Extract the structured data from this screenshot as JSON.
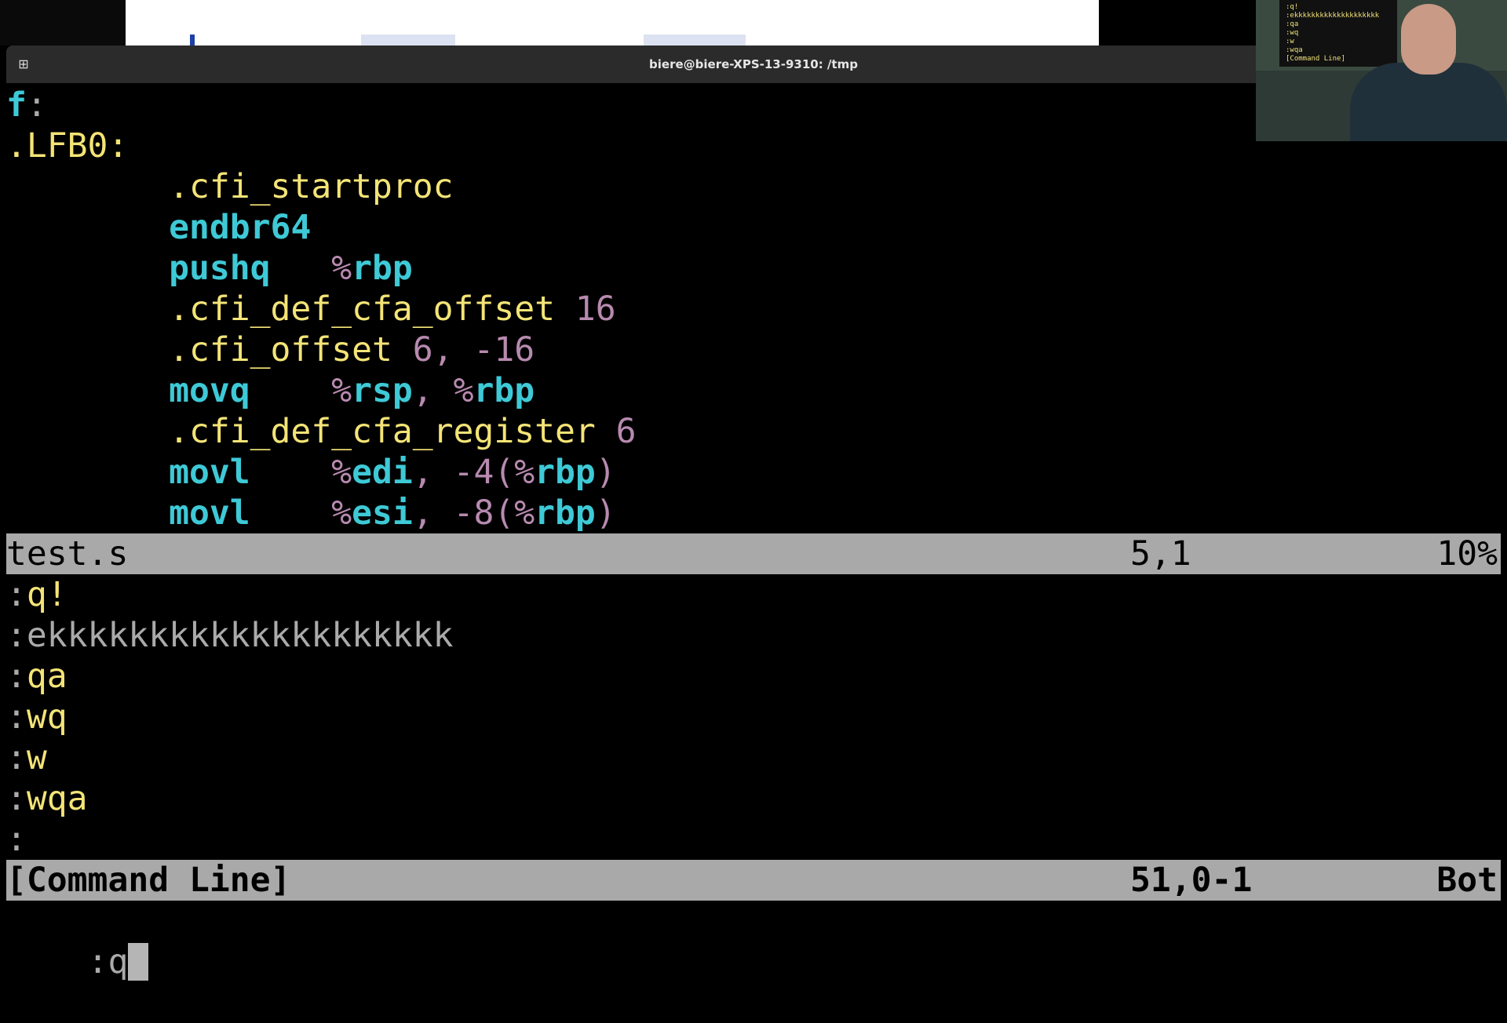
{
  "window": {
    "title": "biere@biere-XPS-13-9310: /tmp",
    "new_tab_icon": "new-tab-icon"
  },
  "editor": {
    "file_lines": [
      [
        {
          "t": "f",
          "k": "c"
        },
        {
          "t": ":",
          "k": "g"
        }
      ],
      [
        {
          "t": ".LFB0:",
          "k": "y"
        }
      ],
      [
        {
          "t": "        .cfi_startproc",
          "k": "y"
        }
      ],
      [
        {
          "t": "        ",
          "k": "g"
        },
        {
          "t": "endbr64",
          "k": "c"
        }
      ],
      [
        {
          "t": "        ",
          "k": "g"
        },
        {
          "t": "pushq",
          "k": "c"
        },
        {
          "t": "   %",
          "k": "m"
        },
        {
          "t": "rbp",
          "k": "c"
        }
      ],
      [
        {
          "t": "        .cfi_def_cfa_offset ",
          "k": "y"
        },
        {
          "t": "16",
          "k": "m"
        }
      ],
      [
        {
          "t": "        .cfi_offset ",
          "k": "y"
        },
        {
          "t": "6, -16",
          "k": "m"
        }
      ],
      [
        {
          "t": "        ",
          "k": "g"
        },
        {
          "t": "movq",
          "k": "c"
        },
        {
          "t": "    %",
          "k": "m"
        },
        {
          "t": "rsp",
          "k": "c"
        },
        {
          "t": ", %",
          "k": "m"
        },
        {
          "t": "rbp",
          "k": "c"
        }
      ],
      [
        {
          "t": "        .cfi_def_cfa_register ",
          "k": "y"
        },
        {
          "t": "6",
          "k": "m"
        }
      ],
      [
        {
          "t": "        ",
          "k": "g"
        },
        {
          "t": "movl",
          "k": "c"
        },
        {
          "t": "    %",
          "k": "m"
        },
        {
          "t": "edi",
          "k": "c"
        },
        {
          "t": ", -4(%",
          "k": "m"
        },
        {
          "t": "rbp",
          "k": "c"
        },
        {
          "t": ")",
          "k": "m"
        }
      ],
      [
        {
          "t": "        ",
          "k": "g"
        },
        {
          "t": "movl",
          "k": "c"
        },
        {
          "t": "    %",
          "k": "m"
        },
        {
          "t": "esi",
          "k": "c"
        },
        {
          "t": ", -8(%",
          "k": "m"
        },
        {
          "t": "rbp",
          "k": "c"
        },
        {
          "t": ")",
          "k": "m"
        }
      ]
    ],
    "status_top": {
      "filename": "test.s",
      "position": "5,1",
      "percent": "10%"
    },
    "cmd_history": [
      {
        "prefix": ":",
        "text": "q!",
        "k": "y"
      },
      {
        "prefix": ":",
        "text": "ekkkkkkkkkkkkkkkkkkkk",
        "k": "g"
      },
      {
        "prefix": ":",
        "text": "qa",
        "k": "y"
      },
      {
        "prefix": ":",
        "text": "wq",
        "k": "y"
      },
      {
        "prefix": ":",
        "text": "w",
        "k": "y"
      },
      {
        "prefix": ":",
        "text": "wqa",
        "k": "y"
      },
      {
        "prefix": ":",
        "text": "",
        "k": "y"
      }
    ],
    "status_bottom": {
      "filename": "[Command Line]",
      "position": "51,0-1",
      "percent": "Bot"
    },
    "command_input": ":q"
  },
  "webcam": {
    "mini_lines": [
      ":q!",
      ":ekkkkkkkkkkkkkkkkkkkk",
      ":qa",
      ":wq",
      ":w",
      ":wqa",
      "[Command Line]"
    ]
  }
}
